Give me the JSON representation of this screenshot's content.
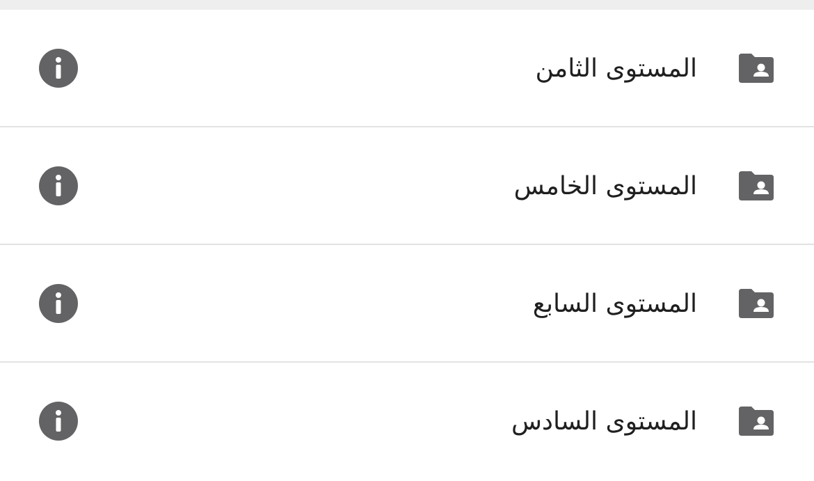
{
  "colors": {
    "icon": "#636366",
    "divider": "#e2e2e2",
    "text": "#1f1f1f",
    "topbar": "#eeeeee"
  },
  "list": {
    "items": [
      {
        "label": "المستوى الثامن",
        "icon": "folder-shared-icon",
        "action_icon": "info-icon"
      },
      {
        "label": "المستوى الخامس",
        "icon": "folder-shared-icon",
        "action_icon": "info-icon"
      },
      {
        "label": "المستوى السابع",
        "icon": "folder-shared-icon",
        "action_icon": "info-icon"
      },
      {
        "label": "المستوى السادس",
        "icon": "folder-shared-icon",
        "action_icon": "info-icon"
      }
    ]
  }
}
